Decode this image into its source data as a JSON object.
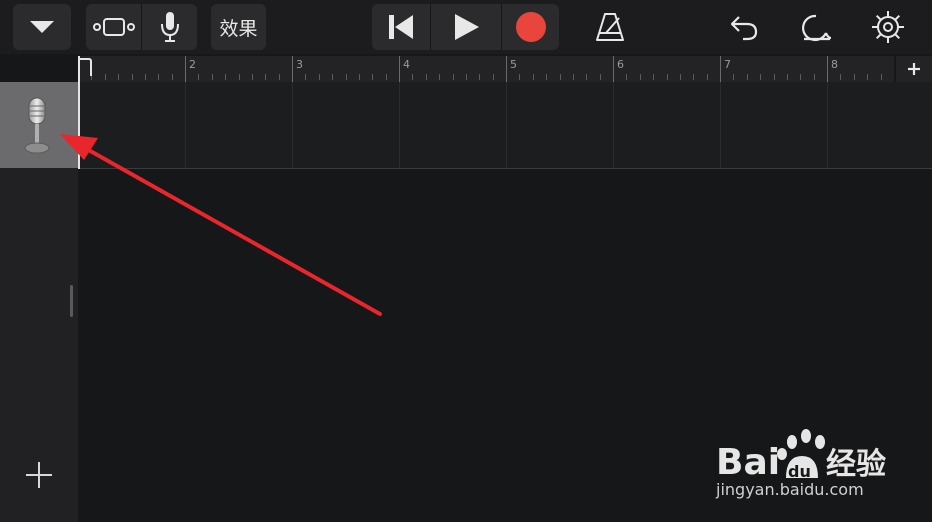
{
  "toolbar": {
    "effects_label": "效果"
  },
  "ruler": {
    "bars": [
      "2",
      "3",
      "4",
      "5",
      "6",
      "7",
      "8"
    ]
  },
  "watermark": {
    "url": "jingyan.baidu.com"
  },
  "colors": {
    "record": "#e8453c",
    "annotation_arrow": "#e8262b",
    "toolbar_bg": "#1c1c1e",
    "button_bg": "#2b2b2d"
  },
  "icons": {
    "dropdown": "chevron-down-icon",
    "tracks_view": "tracks-view-icon",
    "microphone": "microphone-icon",
    "rewind": "go-to-beginning-icon",
    "play": "play-icon",
    "record": "record-icon",
    "metronome": "metronome-icon",
    "undo": "undo-icon",
    "loop": "loop-icon",
    "settings": "settings-gear-icon",
    "add_section": "plus-icon",
    "add_track": "plus-icon",
    "track_instrument": "audio-recorder-microphone-icon"
  }
}
